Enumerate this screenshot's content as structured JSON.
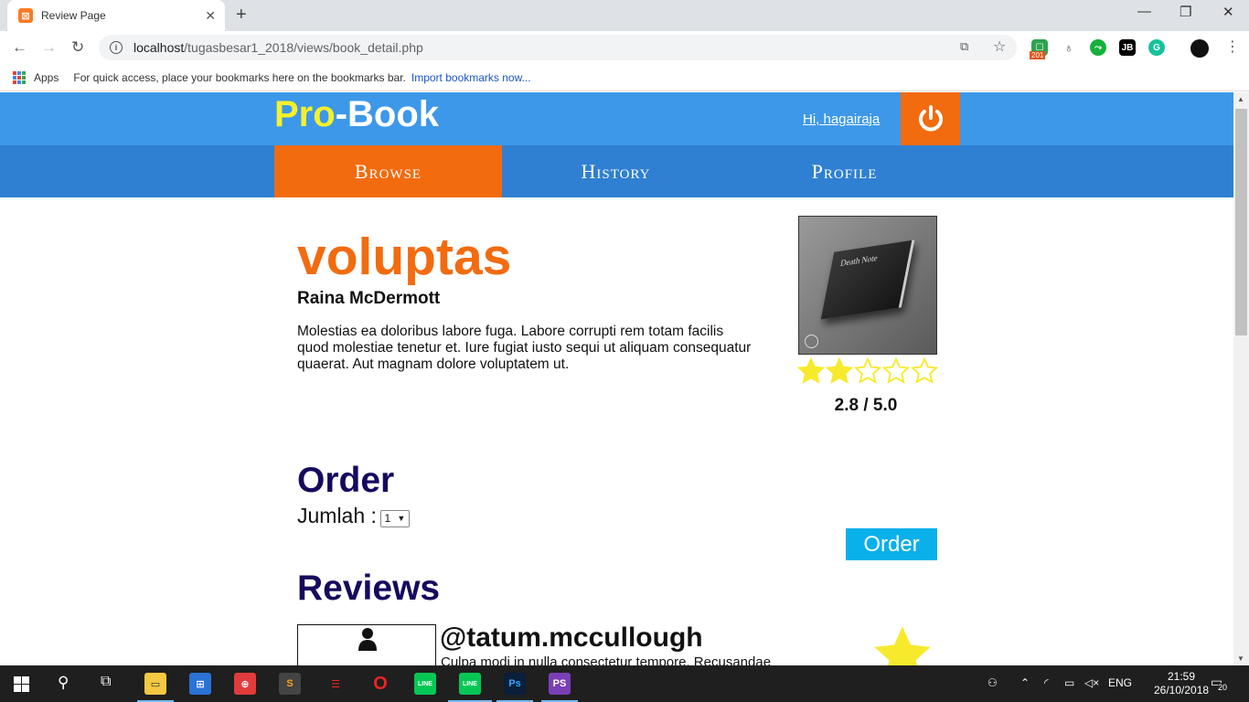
{
  "browser": {
    "tab_title": "Review Page",
    "tab_favicon": "xampp-favicon",
    "url_host": "localhost",
    "url_path": "/tugasbesar1_2018/views/book_detail.php",
    "apps_label": "Apps",
    "bookmarks_hint": "For quick access, place your bookmarks here on the bookmarks bar.",
    "import_link": "Import bookmarks now...",
    "ext_badge": "201"
  },
  "site": {
    "logo_pro": "Pro",
    "logo_rest": "-Book",
    "greeting": "Hi, hagairaja",
    "nav": [
      {
        "label": "Browse"
      },
      {
        "label": "History"
      },
      {
        "label": "Profile"
      }
    ],
    "colors": {
      "header": "#3d98e9",
      "nav": "#2f80d2",
      "accent": "#f26b0f",
      "heading": "#150a5e",
      "button": "#0ab0ea"
    }
  },
  "book": {
    "title": "voluptas",
    "author": "Raina McDermott",
    "description": "Molestias ea doloribus labore fuga. Labore corrupti rem totam facilis quod molestiae tenetur et. Iure fugiat iusto sequi ut aliquam consequatur quaerat. Aut magnam dolore voluptatem ut.",
    "cover_text": "Death Note",
    "filled_stars": 2,
    "total_stars": 5,
    "rating": "2.8 / 5.0"
  },
  "order": {
    "heading": "Order",
    "quantity_label": "Jumlah :",
    "quantity_value": "1",
    "button": "Order"
  },
  "reviews": {
    "heading": "Reviews",
    "items": [
      {
        "username": "@tatum.mccullough",
        "text": "Culpa modi in nulla consectetur tempore. Recusandae"
      }
    ]
  },
  "taskbar": {
    "language": "ENG",
    "time": "21:59",
    "date": "26/10/2018",
    "notifications": "20"
  }
}
